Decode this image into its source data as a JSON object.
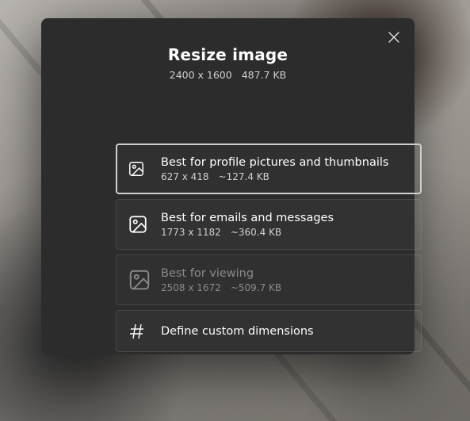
{
  "modal": {
    "title": "Resize image",
    "current_dimensions": "2400 x 1600",
    "current_filesize": "487.7 KB"
  },
  "options": [
    {
      "icon": "image-icon-small",
      "title": "Best for profile pictures and thumbnails",
      "dimensions": "627 x 418",
      "filesize": "~127.4 KB",
      "selected": true,
      "disabled": false
    },
    {
      "icon": "image-icon-medium",
      "title": "Best for emails and messages",
      "dimensions": "1773 x 1182",
      "filesize": "~360.4 KB",
      "selected": false,
      "disabled": false
    },
    {
      "icon": "image-icon-large",
      "title": "Best for viewing",
      "dimensions": "2508 x 1672",
      "filesize": "~509.7 KB",
      "selected": false,
      "disabled": true
    },
    {
      "icon": "hash-icon",
      "title": "Define custom dimensions",
      "dimensions": null,
      "filesize": null,
      "selected": false,
      "disabled": false,
      "single": true
    }
  ]
}
